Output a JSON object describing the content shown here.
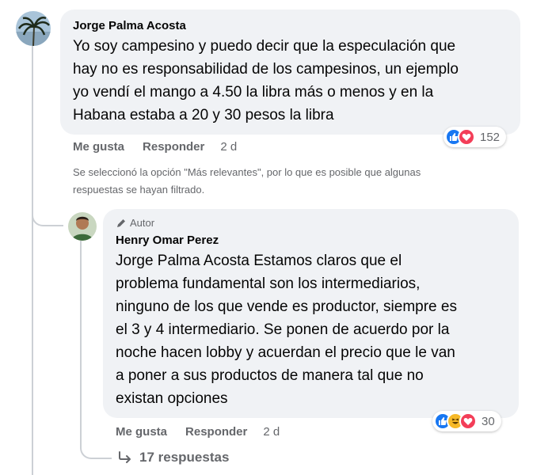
{
  "comment": {
    "author": "Jorge Palma Acosta",
    "text": "Yo soy campesino y puedo decir que la especulación que hay no es responsabilidad de los campesinos, un ejemplo yo vendí el mango a 4.50 la libra más o menos y en la Habana estaba a 20 y 30 pesos la libra",
    "lines": [
      "Yo soy campesino y puedo decir que la especulación que",
      "hay no es responsabilidad de los campesinos, un ejemplo",
      "yo vendí el mango a 4.50 la libra más o menos y en la",
      "Habana estaba a 20 y 30 pesos la libra"
    ],
    "like_label": "Me gusta",
    "reply_label": "Responder",
    "age": "2 d",
    "reaction_count": "152",
    "reaction_icons": [
      "like-icon",
      "love-icon"
    ]
  },
  "filter_notice": {
    "line1": "Se seleccionó la opción \"Más relevantes\", por lo que es posible que algunas",
    "line2": "respuestas se hayan filtrado."
  },
  "reply": {
    "badge_label": "Autor",
    "author": "Henry Omar Perez",
    "mention": "Jorge Palma Acosta",
    "first_line_rest": " Estamos claros que el",
    "lines": [
      "problema fundamental son los intermediarios,",
      "ninguno de los que vende es productor, siempre es",
      "el 3 y 4 intermediario. Se ponen de acuerdo por la",
      "noche hacen lobby y acuerdan el precio que le van",
      "a poner a sus productos de manera tal que no",
      "existan opciones"
    ],
    "like_label": "Me gusta",
    "reply_label": "Responder",
    "age": "2 d",
    "reaction_count": "30",
    "reaction_icons": [
      "like-icon",
      "haha-icon",
      "love-icon"
    ]
  },
  "more_replies": {
    "label": "17 respuestas"
  },
  "colors": {
    "bubble": "#f0f2f5",
    "secondary_text": "#65676b",
    "like_blue": "#1877f2",
    "love_red": "#f33e58",
    "haha_yellow": "#f7b928",
    "thread_line": "#ccd0d5"
  }
}
